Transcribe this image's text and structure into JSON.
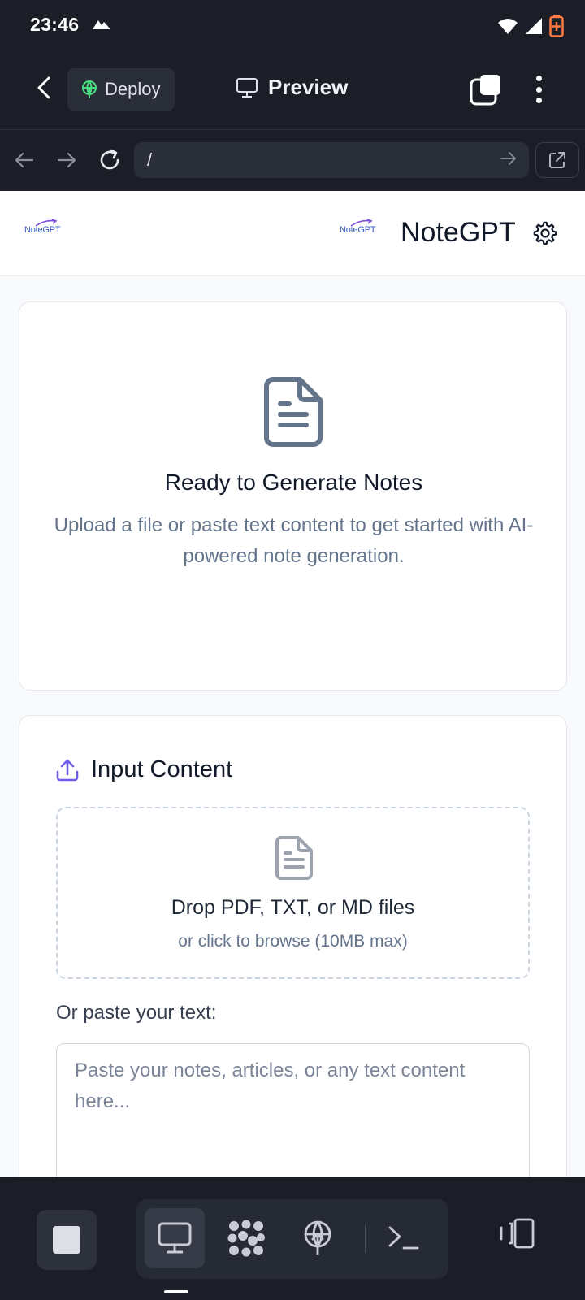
{
  "status": {
    "time": "23:46"
  },
  "header": {
    "deploy_label": "Deploy",
    "preview_label": "Preview"
  },
  "urlbar": {
    "path": "/"
  },
  "site": {
    "logo_text": "NoteGPT",
    "title": "NoteGPT"
  },
  "empty_state": {
    "title": "Ready to Generate Notes",
    "subtitle": "Upload a file or paste text content to get started with AI-powered note generation."
  },
  "input": {
    "section_title": "Input Content",
    "drop_title": "Drop PDF, TXT, or MD files",
    "drop_sub": "or click to browse (10MB max)",
    "paste_label": "Or paste your text:",
    "paste_placeholder": "Paste your notes, articles, or any text content here...",
    "paste_value": ""
  },
  "colors": {
    "dark_bg": "#1b1e27",
    "accent": "#6d5ce8",
    "icon_gray": "#64748b",
    "deploy_green": "#4ade80"
  }
}
